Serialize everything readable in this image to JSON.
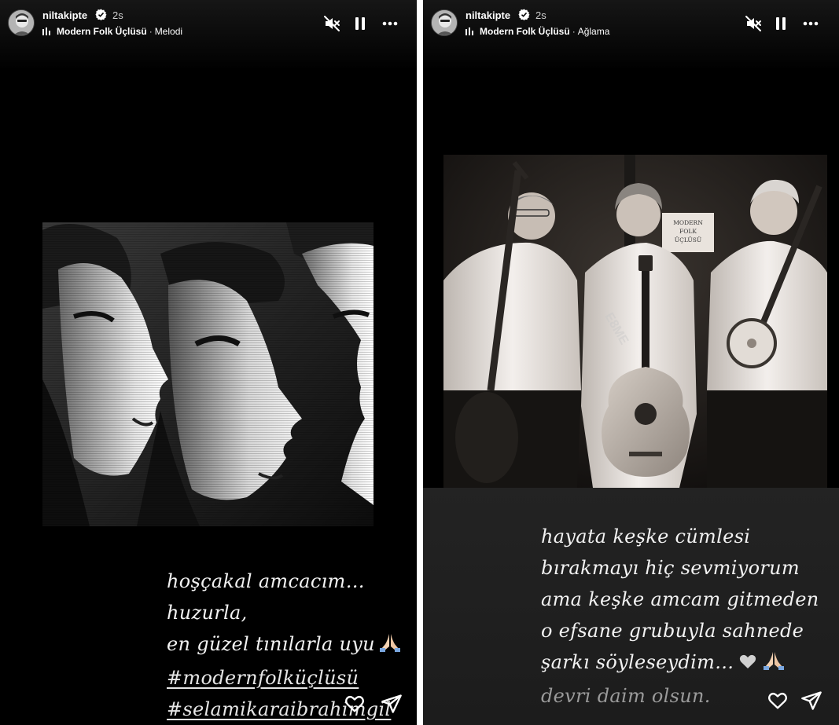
{
  "stories": [
    {
      "username": "niltakipte",
      "time_ago": "2s",
      "music": {
        "artist": "Modern Folk Üçlüsü",
        "separator": "·",
        "song": "Melodi"
      },
      "caption": {
        "lines": [
          "hoşçakal amcacım…",
          "huzurla,",
          "en güzel tınılarla uyu"
        ],
        "emoji": "pray-hands",
        "hashtags": [
          "#modernfolküçlüsü",
          "#selamikaraibrahimgil"
        ]
      },
      "photo": {
        "subject": "three-men-profile-bw"
      },
      "icons": [
        "mute-icon",
        "pause-icon",
        "more-icon",
        "heart-icon",
        "send-icon"
      ]
    },
    {
      "username": "niltakipte",
      "time_ago": "2s",
      "music": {
        "artist": "Modern Folk Üçlüsü",
        "separator": "·",
        "song": "Ağlama"
      },
      "caption": {
        "lines": [
          "hayata keşke cümlesi",
          "bırakmayı hiç sevmiyorum",
          "ama keşke amcam gitmeden",
          "o efsane grubuyla sahnede",
          "şarkı söyleseydim…"
        ],
        "emoji": [
          "white-heart",
          "pray-hands"
        ],
        "last_line": "devri daim olsun."
      },
      "photo": {
        "subject": "three-musicians-with-guitars",
        "sign_text": [
          "MODERN",
          "FOLK",
          "ÜÇLÜSÜ"
        ]
      },
      "icons": [
        "mute-icon",
        "pause-icon",
        "more-icon",
        "heart-icon",
        "send-icon"
      ]
    }
  ],
  "colors": {
    "background": "#000000",
    "caption": "#f2f2f2",
    "caption_faded": "#9a9a9a"
  }
}
